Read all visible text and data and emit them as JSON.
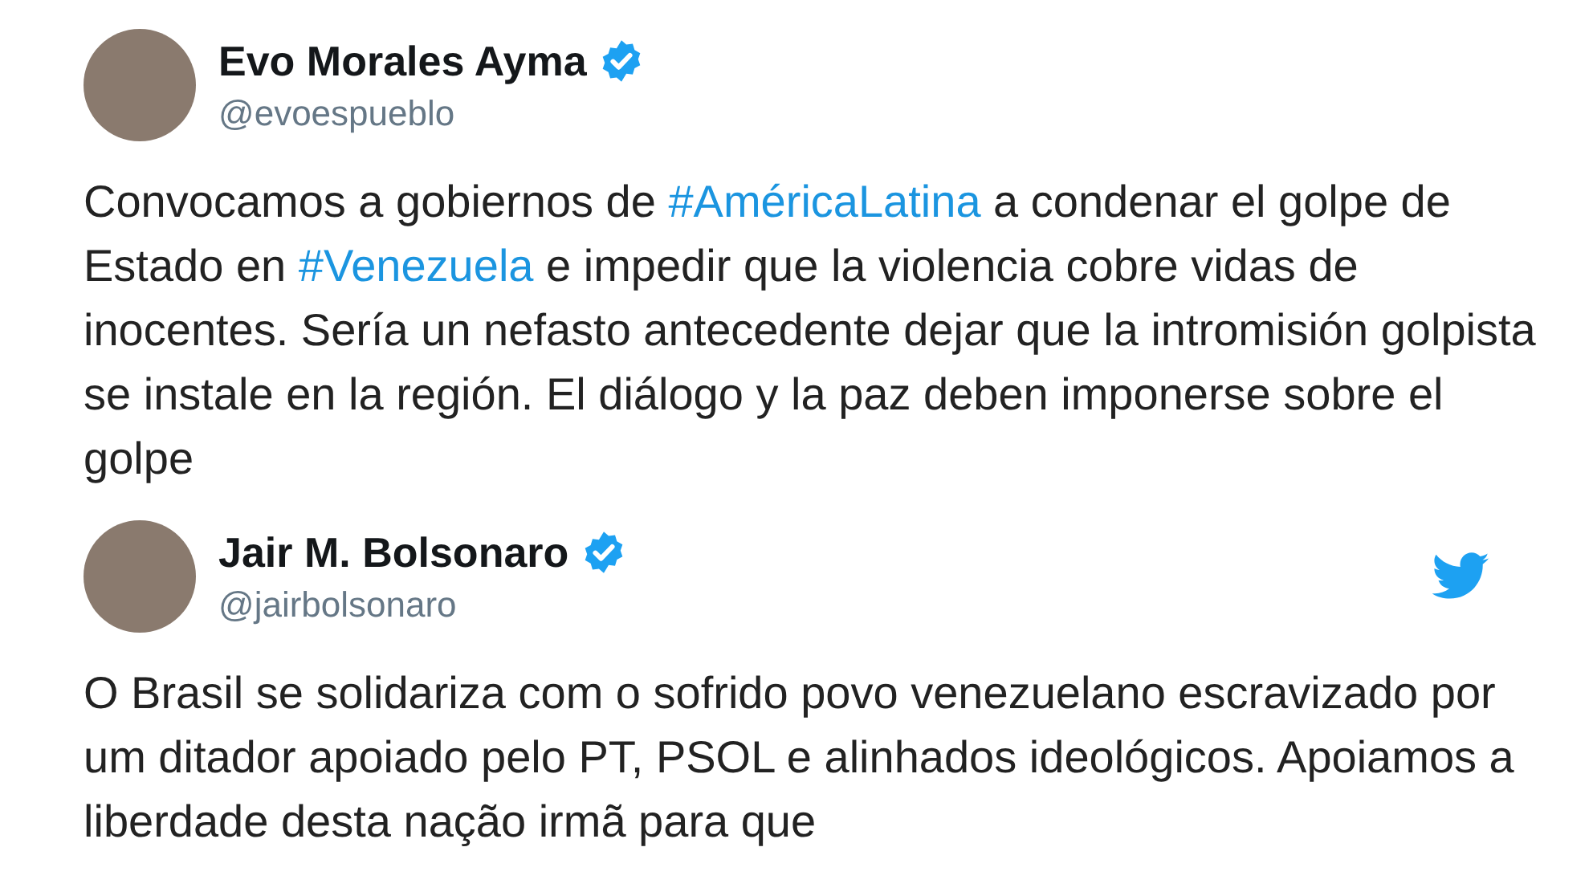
{
  "tweets": [
    {
      "name": "Evo Morales Ayma",
      "handle": "@evoespueblo",
      "verified": true,
      "show_bird": false,
      "text": [
        {
          "kind": "plain",
          "text": "Convocamos a gobiernos de "
        },
        {
          "kind": "hashtag",
          "text": "#AméricaLatina"
        },
        {
          "kind": "plain",
          "text": " a condenar el golpe de Estado en "
        },
        {
          "kind": "hashtag",
          "text": "#Venezuela"
        },
        {
          "kind": "plain",
          "text": " e impedir que la violencia cobre vidas de inocentes. Sería un nefasto antecedente dejar que la intromisión golpista se instale en la región. El diálogo y la paz deben imponerse sobre el golpe"
        }
      ]
    },
    {
      "name": "Jair M. Bolsonaro",
      "handle": "@jairbolsonaro",
      "verified": true,
      "show_bird": true,
      "text": [
        {
          "kind": "plain",
          "text": "O Brasil se solidariza com o sofrido povo venezuelano escravizado por um ditador apoiado pelo PT, PSOL e alinhados ideológicos. Apoiamos a liberdade desta nação irmã para que"
        }
      ]
    }
  ]
}
